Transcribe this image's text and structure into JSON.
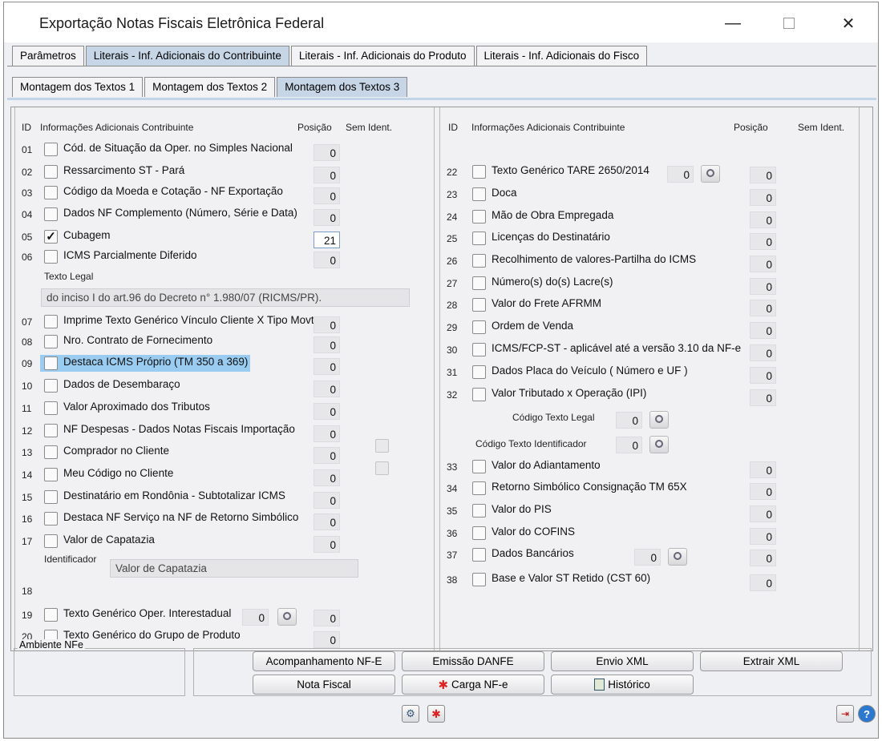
{
  "window": {
    "title": "Exportação Notas Fiscais Eletrônica Federal"
  },
  "tabs_main": [
    "Parâmetros",
    "Literais - Inf. Adicionais do Contribuinte",
    "Literais - Inf. Adicionais do Produto",
    "Literais - Inf. Adicionais do Fisco"
  ],
  "tabs_sub": [
    "Montagem dos Textos 1",
    "Montagem dos Textos 2",
    "Montagem dos Textos 3"
  ],
  "left": {
    "headers": {
      "id": "ID",
      "info": "Informações Adicionais Contribuinte",
      "pos": "Posição",
      "sem": "Sem Ident."
    },
    "rows": [
      {
        "id": "01",
        "label": "Cód. de Situação da Oper. no Simples Nacional",
        "pos": "0"
      },
      {
        "id": "02",
        "label": "Ressarcimento ST - Pará",
        "pos": "0"
      },
      {
        "id": "03",
        "label": "Código da Moeda e Cotação - NF Exportação",
        "pos": "0"
      },
      {
        "id": "04",
        "label": "Dados NF Complemento (Número, Série e Data)",
        "pos": "0"
      },
      {
        "id": "05",
        "label": "Cubagem",
        "pos": "21"
      },
      {
        "id": "06",
        "label": "ICMS Parcialmente Diferido",
        "pos": "0"
      },
      {
        "id": "07",
        "label": "Imprime Texto Genérico Vínculo Cliente X Tipo Movto",
        "pos": "0"
      },
      {
        "id": "08",
        "label": "Nro. Contrato de Fornecimento",
        "pos": "0"
      },
      {
        "id": "09",
        "label": "Destaca ICMS Próprio  (TM 350 a 369)",
        "pos": "0"
      },
      {
        "id": "10",
        "label": "Dados de Desembaraço",
        "pos": "0"
      },
      {
        "id": "11",
        "label": "Valor Aproximado dos Tributos",
        "pos": "0"
      },
      {
        "id": "12",
        "label": "NF Despesas - Dados Notas Fiscais Importação",
        "pos": "0"
      },
      {
        "id": "13",
        "label": "Comprador no Cliente",
        "pos": "0"
      },
      {
        "id": "14",
        "label": "Meu Código no Cliente",
        "pos": "0"
      },
      {
        "id": "15",
        "label": "Destinatário em Rondônia - Subtotalizar ICMS",
        "pos": "0"
      },
      {
        "id": "16",
        "label": "Destaca NF Serviço na NF de Retorno Simbólico",
        "pos": "0"
      },
      {
        "id": "17",
        "label": "Valor de Capatazia",
        "pos": "0"
      },
      {
        "id": "18"
      },
      {
        "id": "19",
        "label": "Texto Genérico Oper. Interestadual",
        "pos": "0",
        "code": "0"
      },
      {
        "id": "20",
        "label": "Texto Genérico do Grupo de Produto",
        "pos": "0"
      }
    ],
    "texto_legal_label": "Texto Legal",
    "texto_legal_value": "do inciso I do art.96 do Decreto n° 1.980/07 (RICMS/PR).",
    "identificador_label": "Identificador",
    "identificador_value": "Valor de Capatazia"
  },
  "right": {
    "headers": {
      "id": "ID",
      "info": "Informações Adicionais Contribuinte",
      "pos": "Posição",
      "sem": "Sem Ident."
    },
    "rows": [
      {
        "id": "22",
        "label": "Texto Genérico TARE 2650/2014",
        "pos": "0",
        "code": "0"
      },
      {
        "id": "23",
        "label": "Doca",
        "pos": "0"
      },
      {
        "id": "24",
        "label": "Mão de Obra Empregada",
        "pos": "0"
      },
      {
        "id": "25",
        "label": "Licenças do Destinatário",
        "pos": "0"
      },
      {
        "id": "26",
        "label": "Recolhimento de valores-Partilha do ICMS",
        "pos": "0"
      },
      {
        "id": "27",
        "label": "Número(s) do(s) Lacre(s)",
        "pos": "0"
      },
      {
        "id": "28",
        "label": "Valor do Frete AFRMM",
        "pos": "0"
      },
      {
        "id": "29",
        "label": "Ordem de Venda",
        "pos": "0"
      },
      {
        "id": "30",
        "label": "ICMS/FCP-ST - aplicável até a versão 3.10 da NF-e",
        "pos": "0"
      },
      {
        "id": "31",
        "label": "Dados Placa do Veículo ( Número e UF )",
        "pos": "0"
      },
      {
        "id": "32",
        "label": "Valor Tributado x Operação (IPI)",
        "pos": "0"
      },
      {
        "id": "33",
        "label": "Valor do Adiantamento",
        "pos": "0"
      },
      {
        "id": "34",
        "label": "Retorno Simbólico Consignação TM 65X",
        "pos": "0"
      },
      {
        "id": "35",
        "label": "Valor do PIS",
        "pos": "0"
      },
      {
        "id": "36",
        "label": "Valor do COFINS",
        "pos": "0"
      },
      {
        "id": "37",
        "label": "Dados Bancários",
        "pos": "0",
        "code": "0"
      },
      {
        "id": "38",
        "label": "Base e Valor ST Retido (CST 60)",
        "pos": "0"
      }
    ],
    "codigo_texto_legal_label": "Código Texto Legal",
    "codigo_texto_legal_value": "0",
    "codigo_texto_ident_label": "Código Texto Identificador",
    "codigo_texto_ident_value": "0"
  },
  "bottom": {
    "ambiente_label": "Ambiente NFe",
    "buttons": [
      "Acompanhamento NF-E",
      "Emissão DANFE",
      "Envio XML",
      "Extrair XML",
      "Nota Fiscal",
      "Carga NF-e",
      "Histórico"
    ]
  }
}
